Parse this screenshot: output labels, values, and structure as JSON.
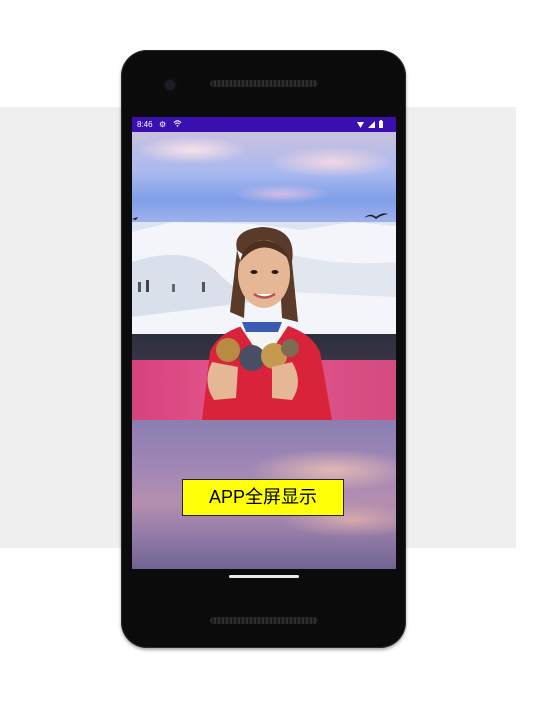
{
  "status_bar": {
    "time": "8:46",
    "settings_icon": "gear-icon",
    "left_network_icon": "wifi-icon",
    "right_icons": [
      "wifi-icon",
      "signal-icon",
      "battery-icon"
    ],
    "background_color": "#3a0fb0"
  },
  "screen": {
    "fullscreen_label": "APP全屏显示",
    "label_background": "#ffff05"
  }
}
